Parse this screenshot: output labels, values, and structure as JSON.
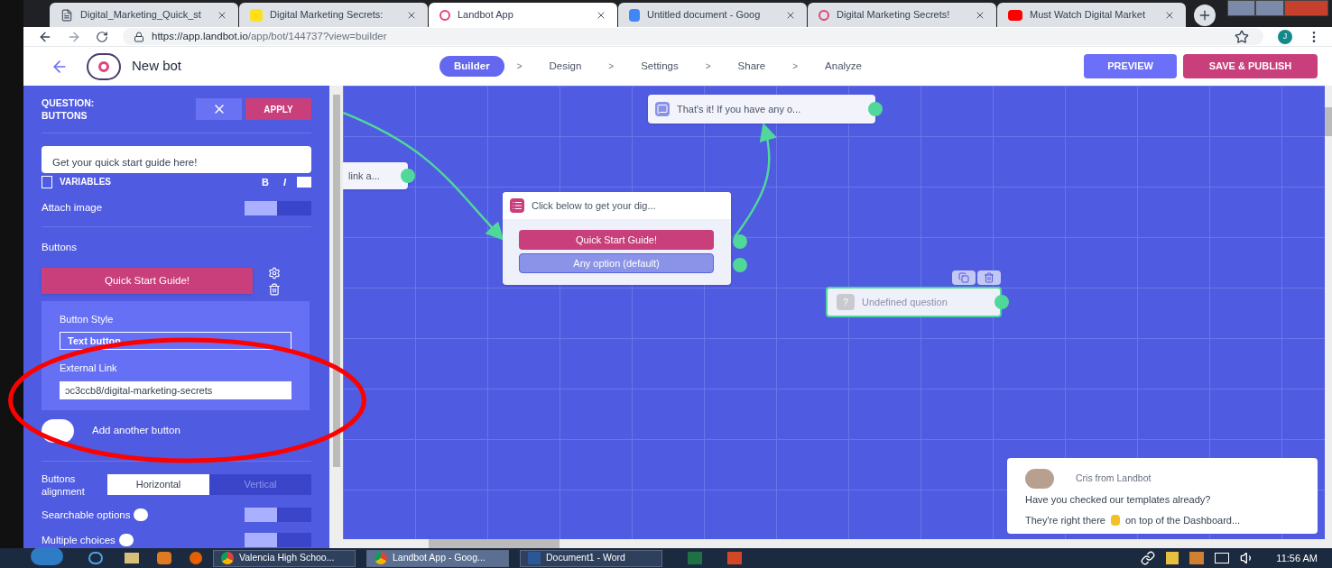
{
  "browser": {
    "tabs": [
      {
        "title": "Digital_Marketing_Quick_st",
        "selected": false,
        "kind": "doc"
      },
      {
        "title": "Digital Marketing Secrets: ",
        "selected": false,
        "kind": "mail"
      },
      {
        "title": "Landbot App",
        "selected": true,
        "kind": "bot"
      },
      {
        "title": "Untitled document - Goog",
        "selected": false,
        "kind": "gdoc"
      },
      {
        "title": "Digital Marketing Secrets! ",
        "selected": false,
        "kind": "bot"
      },
      {
        "title": "Must Watch Digital Market",
        "selected": false,
        "kind": "video"
      }
    ],
    "url_host": "https://app.landbot.io",
    "url_path": "/app/bot/144737?view=builder",
    "profile": "J"
  },
  "header": {
    "title": "New bot",
    "steps": [
      {
        "label": "Builder",
        "selected": true
      },
      {
        "label": "Design",
        "selected": false
      },
      {
        "label": "Settings",
        "selected": false
      },
      {
        "label": "Share",
        "selected": false
      },
      {
        "label": "Analyze",
        "selected": false
      }
    ],
    "separator": ">",
    "preview": "PREVIEW",
    "publish": "SAVE & PUBLISH"
  },
  "sidebar": {
    "title": "QUESTION:\nBUTTONS",
    "apply": "APPLY",
    "message": "Get your quick start guide here!",
    "variables": "VARIABLES",
    "bold": "B",
    "italic": "I",
    "attach_image": {
      "label": "Attach image",
      "on": false
    },
    "buttons_label": "Buttons",
    "button": "Quick Start Guide!",
    "button_style_label": "Button Style",
    "button_style": "Text button",
    "external_link_label": "External Link",
    "external_link": "ɔc3ccb8/digital-marketing-secrets",
    "add_button": "Add another button",
    "alignment": {
      "label": "Buttons alignment",
      "options": [
        {
          "label": "Horizontal",
          "selected": true
        },
        {
          "label": "Vertical",
          "selected": false
        }
      ]
    },
    "toggles": [
      {
        "label": "Searchable options",
        "on": false
      },
      {
        "label": "Multiple choices",
        "on": false
      }
    ]
  },
  "canvas": {
    "nodes": [
      {
        "kind": "partial",
        "text": "link a..."
      },
      {
        "kind": "message",
        "text": "That's it! If you have any o..."
      },
      {
        "kind": "buttons",
        "text": "Click below to get your dig...",
        "options": [
          "Quick Start Guide!",
          "Any option (default)"
        ]
      },
      {
        "kind": "undefined",
        "text": "Undefined question",
        "icon": "?"
      }
    ]
  },
  "chat": {
    "sender": "Cris from Landbot",
    "line1": "Have you checked our templates already?",
    "line2a": "They're right there",
    "line2b": "on top of the Dashboard..."
  },
  "taskbar": {
    "windows": [
      {
        "title": "Valencia High Schoo...",
        "selected": false,
        "kind": "chrome"
      },
      {
        "title": "Landbot App - Goog...",
        "selected": true,
        "kind": "chrome"
      },
      {
        "title": "Document1 - Word",
        "selected": false,
        "kind": "word"
      }
    ],
    "clock": "11:56 AM"
  }
}
